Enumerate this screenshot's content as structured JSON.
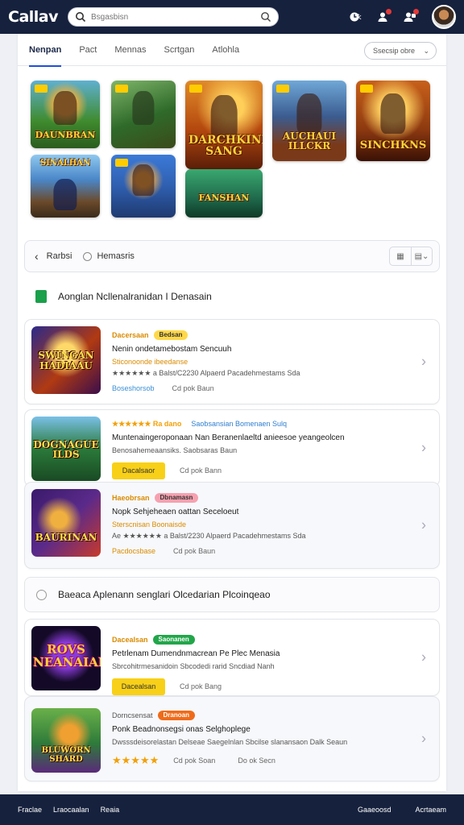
{
  "app": {
    "logo": "Callav"
  },
  "search": {
    "placeholder": "Bsgasbisn"
  },
  "top_actions": [
    {
      "name": "clock-icon",
      "label": "ꝁ"
    },
    {
      "name": "user-icon",
      "label": ""
    },
    {
      "name": "people-icon",
      "label": ""
    }
  ],
  "tabs": [
    "Nenpan",
    "Pact",
    "Mennas",
    "Scrtgan",
    "Atlohla"
  ],
  "sort": {
    "label": "Ssecsip obre"
  },
  "tiles": [
    {
      "title": "DAUNBRAN",
      "bg": "#3f8b2e"
    },
    {
      "title": "",
      "bg": "#2f6a2a"
    },
    {
      "title": "DARCHKINK SANG",
      "bg": "#b4480e"
    },
    {
      "title": "AUCHAUI ILLCKR",
      "bg": "#3b5b8f"
    },
    {
      "title": "SINCHKNS",
      "bg": "#8e3a10"
    },
    {
      "title": "SINALHAN",
      "bg": "#4a86c8"
    },
    {
      "title": "",
      "bg": "#2f5fb0"
    },
    {
      "title": "FANSHAN",
      "bg": "#1f6a4c"
    }
  ],
  "filter": {
    "back_label": "Rarbsi",
    "label": "Hemasris"
  },
  "section1": {
    "title": "Aonglan Ncllenalranidan I Denasain"
  },
  "section2": {
    "title": "Baeaca Aplenann senglari Olcedarian Plcoinqeao"
  },
  "items": [
    {
      "thumb_title": "SWINGAN HADIAAU",
      "thumb_bg": "#b03a12",
      "meta": "Dacersaan",
      "pill": "Bedsan",
      "pill_color": "#ffd84a",
      "title": "Nenin ondetamebostam Sencuuh",
      "desc": "Sticonoonde ibeedanse",
      "stats": "★★★★★★  a Balst/C2230  Alpaerd Pacadehmestams Sda",
      "link": "Boseshorsob",
      "time": "Cd pok Baun"
    },
    {
      "thumb_title": "DOGNAGUE ILDS",
      "thumb_bg": "#2a7a3a",
      "meta": "★★★★★★ Ra dano",
      "meta_link": "Saobsansian Bomenaen Sulq",
      "title": "Muntenaingeroponaan Nan Beranenlaeltd anieesoe yeangeolcen",
      "desc": "Benosahemeaansiks.  Saobsaras Baun",
      "button": "Dacalsaor",
      "time": "Cd pok Bann"
    },
    {
      "thumb_title": "BAURINAN",
      "thumb_bg": "#5a2a8a",
      "meta": "Haeobrsan",
      "pill": "Dbnamasn",
      "pill_color": "#f6a1b0",
      "title": "Nopk Sehjeheaen oattan Seceloeut",
      "desc": "Sterscnisan Boonaisde",
      "stats": "Ae ★★★★★★  a Balst/2230  Alpaerd Pacadehmestams Sda",
      "link": "Pacdocsbase",
      "time": "Cd pok Baun"
    },
    {
      "thumb_title": "ROVS NEANAIAN",
      "thumb_bg": "#1a0f30",
      "meta": "Dacealsan",
      "pill": "Saonanen",
      "pill_color": "#22a64a",
      "title": "Petrlenam Dumendnmacrean Pe Plec Menasia",
      "desc": "Sbrcohitrmesanidoin Sbcodedi rarid Sncdiad Nanh",
      "button": "Dacealsan",
      "time": "Cd pok Bang"
    },
    {
      "thumb_title": "BLUWORN SHARD",
      "thumb_bg": "#2e7a3a",
      "meta": "Dorncsensat",
      "pill": "Dranoan",
      "pill_color": "#ef6b1a",
      "title": "Ponk Beadnonsegsi onas Selghoplege",
      "desc": "Dwsssdeisorelastan Delseae Saegelnlan Sbcilse slanansaon Dalk Seaun",
      "stars": "★★★★★",
      "time": "Cd pok Soan",
      "time2": "Do ok Secn"
    }
  ],
  "bottom_nav": {
    "left": [
      "Fraclae",
      "Lraocaalan",
      "Reaia"
    ],
    "right": [
      "Gaaeoosd",
      "Acrtaeam"
    ]
  },
  "colors": {
    "navy": "#16213d",
    "accent_blue": "#1f4fd6",
    "yellow": "#f8d018",
    "green": "#1aa04a"
  }
}
